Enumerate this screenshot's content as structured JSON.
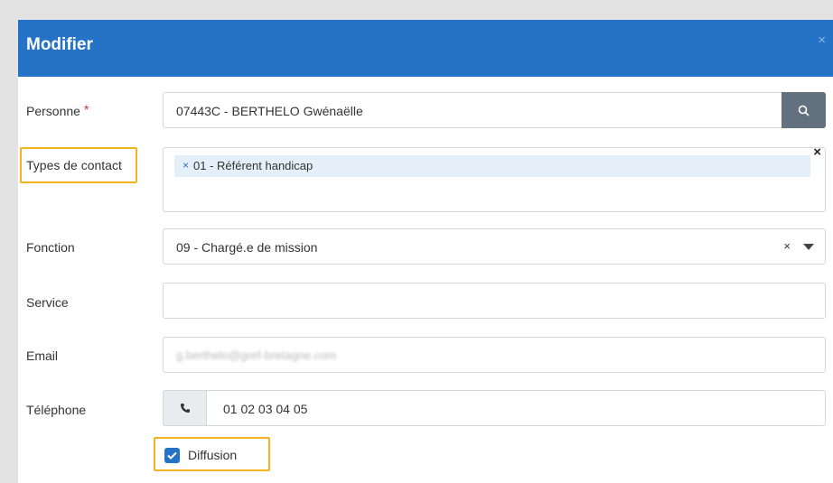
{
  "modal": {
    "title": "Modifier",
    "close_symbol": "×"
  },
  "form": {
    "personne": {
      "label": "Personne",
      "required_mark": "*",
      "value": "07443C - BERTHELO Gwénaëlle",
      "button_icon": "search-icon"
    },
    "types_contact": {
      "label": "Types de contact",
      "tags": [
        {
          "remove_symbol": "×",
          "label": "01 - Référent handicap"
        }
      ],
      "clear_symbol": "×"
    },
    "fonction": {
      "label": "Fonction",
      "value": "09 - Chargé.e de mission",
      "clear_symbol": "×",
      "dropdown_icon": "caret-down-icon"
    },
    "service": {
      "label": "Service",
      "value": ""
    },
    "email": {
      "label": "Email",
      "value": "g.berthelo@gref-bretagne.com"
    },
    "telephone": {
      "label": "Téléphone",
      "value": "01 02 03 04 05",
      "addon_icon": "phone-icon"
    },
    "diffusion": {
      "label": "Diffusion",
      "checked": true
    }
  },
  "colors": {
    "header": "#2473c7",
    "search_button": "#63707d",
    "highlight": "#f4b21e",
    "required": "#e02b2b",
    "tag_background": "#e5eff9"
  }
}
